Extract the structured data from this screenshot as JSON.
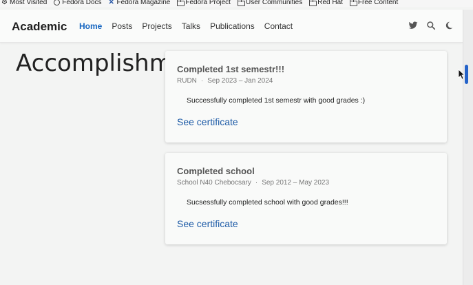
{
  "bookmarks": [
    {
      "label": "Most Visited",
      "icon": "gear-icon"
    },
    {
      "label": "Fedora Docs",
      "icon": "globe-icon"
    },
    {
      "label": "Fedora Magazine",
      "icon": "magazine-icon"
    },
    {
      "label": "Fedora Project",
      "icon": "folder-icon"
    },
    {
      "label": "User Communities",
      "icon": "folder-icon"
    },
    {
      "label": "Red Hat",
      "icon": "folder-icon"
    },
    {
      "label": "Free Content",
      "icon": "folder-icon"
    }
  ],
  "navbar": {
    "brand": "Academic",
    "links": [
      "Home",
      "Posts",
      "Projects",
      "Talks",
      "Publications",
      "Contact"
    ],
    "active": "Home",
    "icons": [
      "twitter-icon",
      "search-icon",
      "dark-mode-icon"
    ]
  },
  "section": {
    "title": "Accomplishments"
  },
  "cards": [
    {
      "title": "Completed 1st semestr!!!",
      "org": "RUDN",
      "dates": "Sep 2023 – Jan 2024",
      "description": "Successfully completed 1st semestr with good grades :)",
      "link": "See certificate"
    },
    {
      "title": "Completed school",
      "org": "School N40 Chebocsary",
      "dates": "Sep 2012 – May 2023",
      "description": "Sucsessfully completed school with good grades!!!",
      "link": "See certificate"
    }
  ],
  "colors": {
    "accent": "#1565c0",
    "link": "#1c5aa6",
    "scroll_thumb": "#2563c9"
  }
}
